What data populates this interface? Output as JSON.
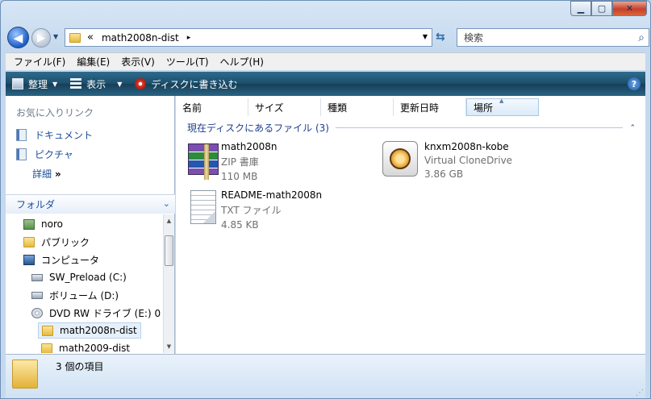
{
  "window": {
    "controls": {
      "minimize": "▁",
      "maximize": "▢",
      "close": "✕"
    }
  },
  "address": {
    "separator": "«",
    "path": "math2008n-dist",
    "arrow": "▸",
    "dropdown": "▼",
    "refresh": "⇆"
  },
  "search": {
    "placeholder": "検索",
    "icon": "⌕"
  },
  "menu": [
    "ファイル(F)",
    "編集(E)",
    "表示(V)",
    "ツール(T)",
    "ヘルプ(H)"
  ],
  "commands": {
    "organize": "整理",
    "view": "表示",
    "burn": "ディスクに書き込む",
    "help": "?"
  },
  "favorites": {
    "title": "お気に入りリンク",
    "items": [
      "ドキュメント",
      "ピクチャ"
    ],
    "more": "詳細",
    "more_icon": "»"
  },
  "folders": {
    "title": "フォルダ",
    "chevron": "⌄",
    "tree": [
      {
        "label": "noro",
        "icon": "user"
      },
      {
        "label": "パブリック",
        "icon": "folder"
      },
      {
        "label": "コンピュータ",
        "icon": "computer"
      },
      {
        "label": "SW_Preload (C:)",
        "icon": "drive"
      },
      {
        "label": "ボリューム (D:)",
        "icon": "drive"
      },
      {
        "label": "DVD RW ドライブ (E:) 0",
        "icon": "disc"
      },
      {
        "label": "math2008n-dist",
        "icon": "folder"
      },
      {
        "label": "math2009-dist",
        "icon": "folder"
      }
    ]
  },
  "columns": [
    "名前",
    "サイズ",
    "種類",
    "更新日時",
    "場所"
  ],
  "group": {
    "label": "現在ディスクにあるファイル (3)",
    "collapse": "⌃"
  },
  "files": [
    {
      "name": "math2008n",
      "type": "ZIP 書庫",
      "size": "110 MB"
    },
    {
      "name": "knxm2008n-kobe",
      "type": "Virtual CloneDrive",
      "size": "3.86 GB"
    },
    {
      "name": "README-math2008n",
      "type": "TXT ファイル",
      "size": "4.85 KB"
    }
  ],
  "status": {
    "text": "3 個の項目"
  }
}
